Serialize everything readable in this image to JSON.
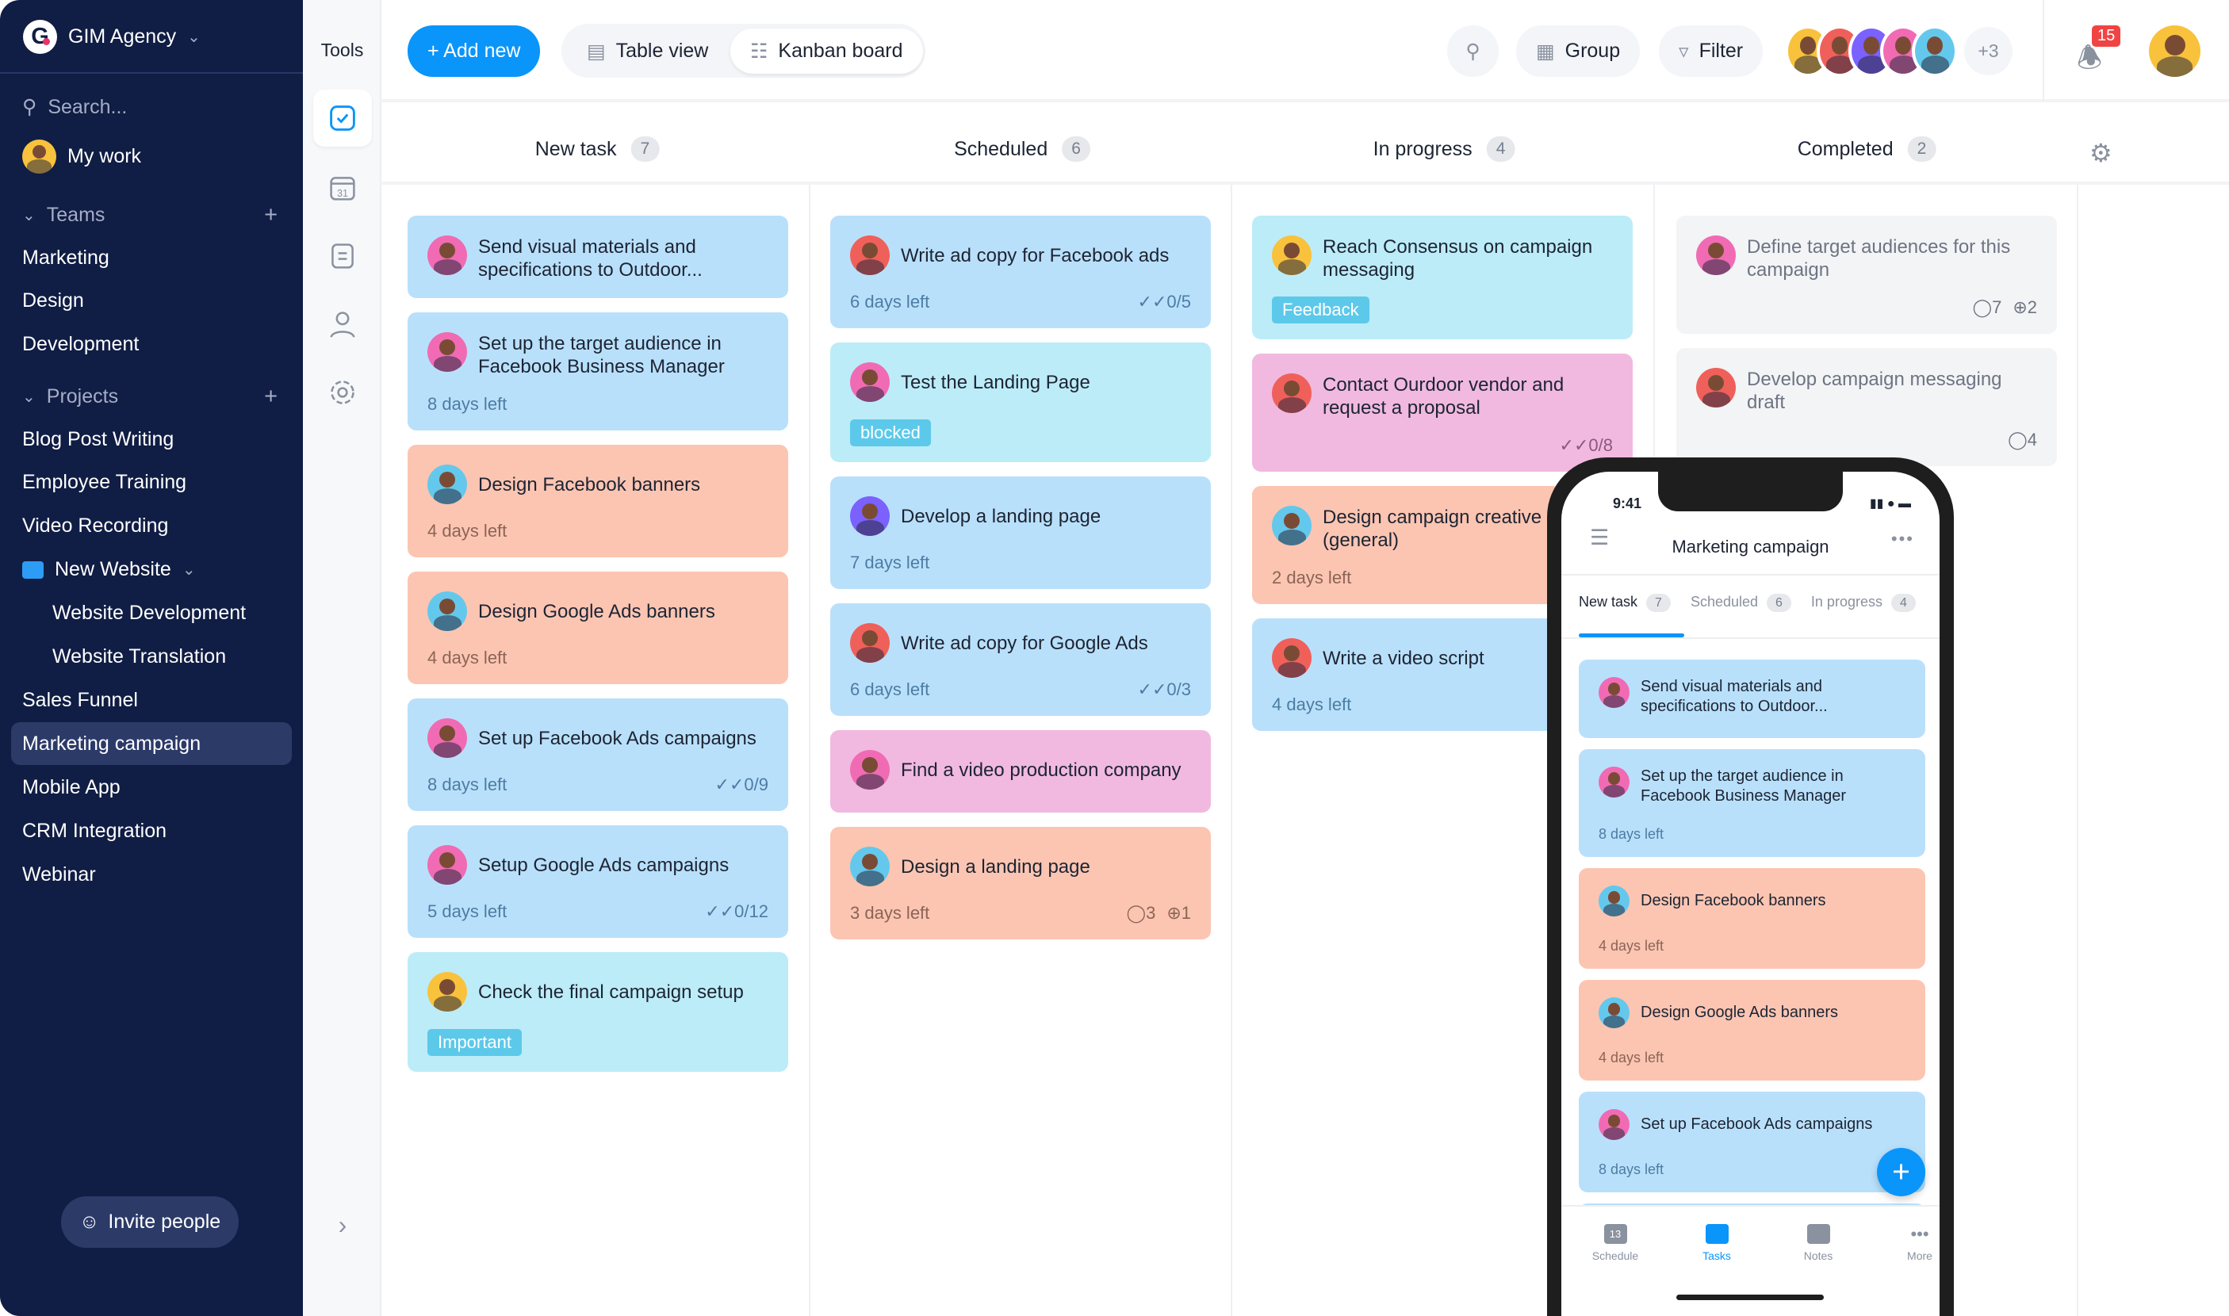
{
  "sidebar": {
    "workspace": "GIM Agency",
    "search_placeholder": "Search...",
    "my_work": "My work",
    "teams_label": "Teams",
    "teams": [
      "Marketing",
      "Design",
      "Development"
    ],
    "projects_label": "Projects",
    "projects": [
      "Blog Post Writing",
      "Employee Training",
      "Video Recording"
    ],
    "folder": "New Website",
    "folder_items": [
      "Website Development",
      "Website Translation"
    ],
    "more_projects": [
      "Sales Funnel",
      "Marketing campaign",
      "Mobile App",
      "CRM Integration",
      "Webinar"
    ],
    "active": "Marketing campaign",
    "invite": "Invite people"
  },
  "tools": {
    "title": "Tools",
    "items": [
      "tasks-icon",
      "calendar-icon",
      "notes-icon",
      "user-icon",
      "gear-icon"
    ],
    "calendar_day": "31"
  },
  "header": {
    "add_new": "+ Add new",
    "table_view": "Table view",
    "kanban_board": "Kanban board",
    "group": "Group",
    "filter": "Filter",
    "more_members": "+3",
    "notifications": "15"
  },
  "colors": {
    "accent": "#0a95fa",
    "sidebar": "#101d44",
    "badge": "#f04444"
  },
  "columns": [
    {
      "name": "New task",
      "count": "7",
      "cards": [
        {
          "title": "Send visual materials and specifications to Outdoor...",
          "color": "blue",
          "avatar": "#f06bb4"
        },
        {
          "title": "Set up the target audience in Facebook Business Manager",
          "days": "8 days left",
          "color": "blue",
          "avatar": "#f06bb4"
        },
        {
          "title": "Design Facebook banners",
          "days": "4 days left",
          "color": "salmon",
          "avatar": "#64c8ec"
        },
        {
          "title": "Design Google Ads banners",
          "days": "4 days left",
          "color": "salmon",
          "avatar": "#64c8ec"
        },
        {
          "title": "Set up Facebook Ads campaigns",
          "days": "8 days left",
          "checks": "0/9",
          "color": "blue",
          "avatar": "#f06bb4"
        },
        {
          "title": "Setup Google Ads campaigns",
          "days": "5 days left",
          "checks": "0/12",
          "color": "blue",
          "avatar": "#f06bb4"
        },
        {
          "title": "Check the final campaign setup",
          "tag": "Important",
          "color": "cyan",
          "avatar": "#f9c23c"
        }
      ]
    },
    {
      "name": "Scheduled",
      "count": "6",
      "cards": [
        {
          "title": "Write ad copy for Facebook ads",
          "days": "6 days left",
          "checks": "0/5",
          "color": "blue",
          "avatar": "#f0605a"
        },
        {
          "title": "Test the Landing Page",
          "tag": "blocked",
          "color": "cyan",
          "avatar": "#f06bb4"
        },
        {
          "title": "Develop a landing page",
          "days": "7 days left",
          "color": "blue",
          "avatar": "#7b61ff"
        },
        {
          "title": "Write ad copy for Google Ads",
          "days": "6 days left",
          "checks": "0/3",
          "color": "blue",
          "avatar": "#f0605a"
        },
        {
          "title": "Find a video production company",
          "color": "pink",
          "avatar": "#f06bb4"
        },
        {
          "title": "Design a landing page",
          "days": "3 days left",
          "comments": "3",
          "attachments": "1",
          "color": "salmon",
          "avatar": "#64c8ec"
        }
      ]
    },
    {
      "name": "In progress",
      "count": "4",
      "cards": [
        {
          "title": "Reach Consensus on campaign messaging",
          "tag": "Feedback",
          "color": "cyan",
          "avatar": "#f9c23c"
        },
        {
          "title": "Contact Ourdoor vendor and request a proposal",
          "checks": "0/8",
          "color": "pink",
          "avatar": "#f0605a"
        },
        {
          "title": "Design campaign creative (general)",
          "days": "2 days left",
          "color": "salmon",
          "avatar": "#64c8ec"
        },
        {
          "title": "Write a video script",
          "days": "4 days left",
          "color": "blue",
          "avatar": "#f0605a"
        }
      ]
    },
    {
      "name": "Completed",
      "count": "2",
      "cards": [
        {
          "title": "Define target audiences for this campaign",
          "comments": "7",
          "attachments": "2",
          "color": "gray",
          "avatar": "#f06bb4"
        },
        {
          "title": "Develop campaign messaging draft",
          "comments": "4",
          "color": "gray",
          "avatar": "#f0605a"
        }
      ]
    }
  ],
  "phone": {
    "time": "9:41",
    "title": "Marketing campaign",
    "tabs": [
      {
        "label": "New task",
        "count": "7"
      },
      {
        "label": "Scheduled",
        "count": "6"
      },
      {
        "label": "In progress",
        "count": "4"
      }
    ],
    "cards": [
      {
        "title": "Send visual materials and specifications to Outdoor...",
        "color": "blue",
        "avatar": "#f06bb4"
      },
      {
        "title": "Set up the target audience in Facebook Business Manager",
        "days": "8 days left",
        "color": "blue",
        "avatar": "#f06bb4"
      },
      {
        "title": "Design Facebook banners",
        "days": "4 days left",
        "color": "salmon",
        "avatar": "#64c8ec"
      },
      {
        "title": "Design Google Ads banners",
        "days": "4 days left",
        "color": "salmon",
        "avatar": "#64c8ec"
      },
      {
        "title": "Set up Facebook Ads campaigns",
        "days": "8 days left",
        "color": "blue",
        "avatar": "#f06bb4"
      }
    ],
    "nav": [
      {
        "label": "Schedule",
        "day": "13"
      },
      {
        "label": "Tasks"
      },
      {
        "label": "Notes"
      },
      {
        "label": "More"
      }
    ]
  }
}
